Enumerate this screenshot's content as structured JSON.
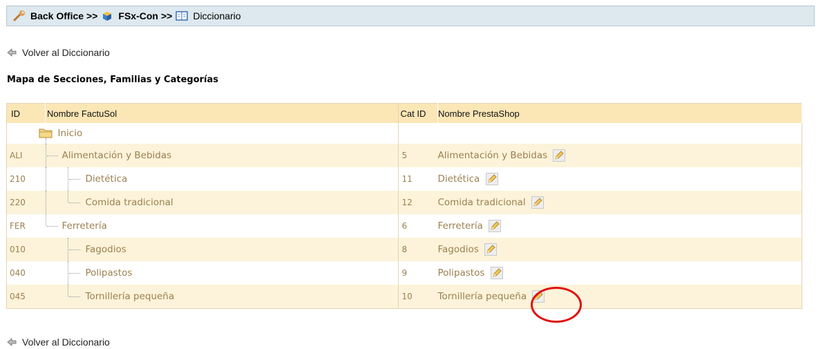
{
  "breadcrumb": {
    "items": [
      "Back Office",
      "FSx-Con",
      "Diccionario"
    ],
    "separator": ">>"
  },
  "back_link": {
    "label": "Volver al Diccionario"
  },
  "section_title": "Mapa de Secciones, Familias y Categorías",
  "table": {
    "headers": {
      "id": "ID",
      "name": "Nombre FactuSol",
      "cat_id": "Cat ID",
      "ps_name": "Nombre PrestaShop"
    },
    "root": {
      "label": "Inicio"
    },
    "rows": [
      {
        "id": "ALI",
        "name": "Alimentación y Bebidas",
        "cat_id": "5",
        "ps_name": "Alimentación y Bebidas"
      },
      {
        "id": "210",
        "name": "Dietética",
        "cat_id": "11",
        "ps_name": "Dietética"
      },
      {
        "id": "220",
        "name": "Comida tradicional",
        "cat_id": "12",
        "ps_name": "Comida tradicional"
      },
      {
        "id": "FER",
        "name": "Ferretería",
        "cat_id": "6",
        "ps_name": "Ferretería"
      },
      {
        "id": "010",
        "name": "Fagodios",
        "cat_id": "8",
        "ps_name": "Fagodios"
      },
      {
        "id": "040",
        "name": "Polipastos",
        "cat_id": "9",
        "ps_name": "Polipastos"
      },
      {
        "id": "045",
        "name": "Tornillería pequeña",
        "cat_id": "10",
        "ps_name": "Tornillería pequeña"
      }
    ]
  },
  "colors": {
    "row_odd": "#fcf3da",
    "header": "#fbe6b6",
    "text": "#9c8050",
    "annotation": "#e01010"
  },
  "icons": [
    "wrench-icon",
    "cube-icon",
    "book-icon",
    "back-arrow-icon",
    "folder-icon",
    "pencil-icon"
  ]
}
